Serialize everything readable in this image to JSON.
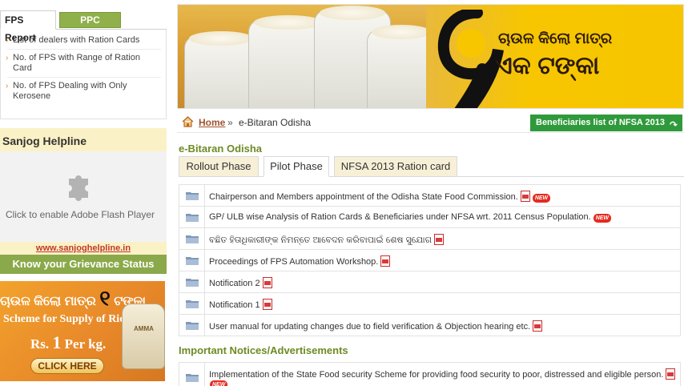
{
  "left": {
    "report_tabs": [
      "FPS Report",
      "PPC Report"
    ],
    "report_items": [
      "List of dealers with Ration Cards",
      "No. of FPS with Range of Ration Card",
      "No. of FPS Dealing with Only Kerosene"
    ],
    "sanjog_title": "Sanjog Helpline",
    "flash_text": "Click to enable Adobe Flash Player",
    "sanjog_link": "www.sanjoghelpline.in",
    "grievance": "Know your Grievance Status",
    "rice_banner": {
      "odia_line": "ଚାଉଳ କିଲୋ ମାତ୍ର",
      "odia_number": "୧",
      "odia_suffix": "ଟଙ୍କା",
      "scheme": "Scheme for Supply of Rice",
      "rs": "Rs.",
      "one": "1",
      "per_kg": "Per kg.",
      "click": "CLICK HERE"
    }
  },
  "hero": {
    "line1": "ଚାଉଳ କିଲୋ ମାତ୍ର",
    "line2": "ଏକ ଟଙ୍କା"
  },
  "breadcrumb": {
    "home": "Home",
    "sep": "»",
    "current": "e-Bitaran Odisha"
  },
  "beneficiaries_button": "Beneficiaries list of NFSA 2013",
  "section_title": "e-Bitaran Odisha",
  "tabs": [
    "Rollout Phase",
    "Pilot Phase",
    "NFSA 2013 Ration card"
  ],
  "active_tab": "Pilot Phase",
  "documents": [
    {
      "text": "Chairperson and Members appointment of the Odisha State Food Commission.",
      "new": true
    },
    {
      "text": "GP/ ULB wise Analysis of Ration Cards & Beneficiaries under NFSA wrt. 2011 Census Population.",
      "new": true
    },
    {
      "text": "ବଛିତ ହିତାଧିକାରୀଙ୍କ ନିମନ୍ତେ ଆବେଦନ କରିବାପାଇଁ ଶେଷ ସୁଯୋଗ",
      "new": false
    },
    {
      "text": "Proceedings of FPS Automation Workshop.",
      "new": false
    },
    {
      "text": "Notification 2",
      "new": false
    },
    {
      "text": "Notification 1",
      "new": false
    },
    {
      "text": "User manual for updating changes due to field verification & Objection hearing etc.",
      "new": false
    }
  ],
  "notices_title": "Important Notices/Advertisements",
  "notices": [
    {
      "text": "Implementation of the State Food security Scheme for providing food security to poor, distressed and eligible person.",
      "new": true
    }
  ],
  "new_badge": "NEW",
  "sack_label": "AMMA",
  "colors": {
    "accent_green": "#8aa94a",
    "title_green": "#6e8a24",
    "button_green": "#2f9a3b",
    "tab_bg": "#f7f0d7",
    "link_brown": "#a0522d"
  }
}
